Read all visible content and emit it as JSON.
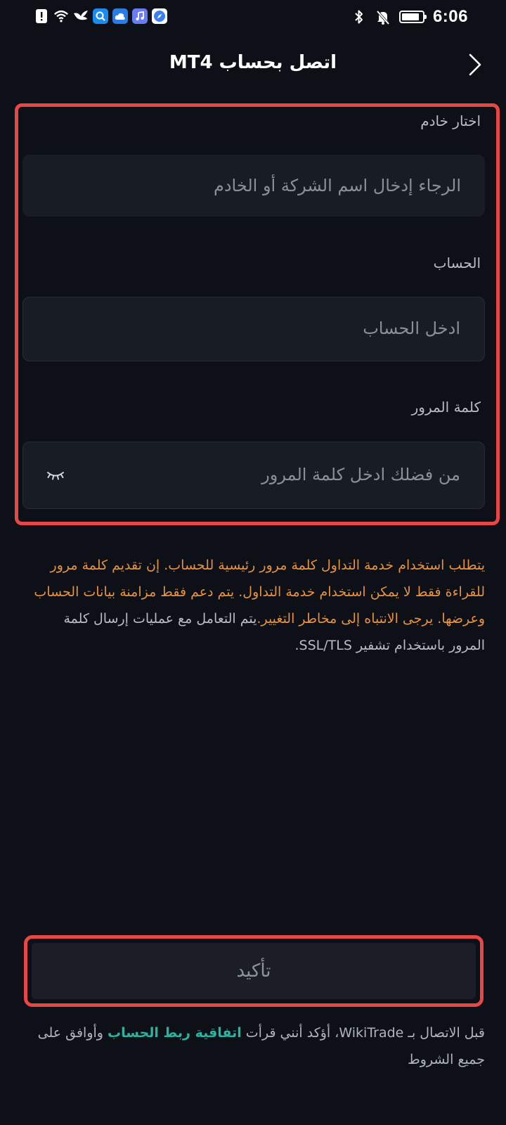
{
  "status_bar": {
    "time": "6:06",
    "battery_level": 0.85,
    "left_icons": [
      "alert-icon",
      "wifi-icon",
      "bird-icon",
      "search-app-icon",
      "cloud-app-icon",
      "music-app-icon",
      "compass-app-icon"
    ],
    "right_icons": [
      "bluetooth-icon",
      "bell-muted-icon",
      "battery-icon"
    ]
  },
  "header": {
    "title": "اتصل بحساب MT4",
    "back_icon": "chevron-right-icon"
  },
  "form": {
    "server": {
      "label": "اختار خادم",
      "placeholder": "الرجاء إدخال اسم الشركة أو الخادم"
    },
    "account": {
      "label": "الحساب",
      "placeholder": "ادخل الحساب"
    },
    "password": {
      "label": "كلمة المرور",
      "placeholder": "من فضلك ادخل كلمة المرور",
      "toggle_icon": "eye-closed-icon"
    }
  },
  "notice": {
    "warning_text": "يتطلب استخدام خدمة التداول كلمة مرور رئيسية للحساب. إن تقديم كلمة مرور للقراءة فقط لا يمكن استخدام خدمة التداول. يتم دعم فقط مزامنة بيانات الحساب وعرضها. يرجى الانتباه إلى مخاطر التغيير.",
    "info_text": "يتم التعامل مع عمليات إرسال كلمة المرور باستخدام تشفير SSL/TLS."
  },
  "confirm_label": "تأكيد",
  "agreement": {
    "before": "قبل الاتصال بـ WikiTrade، أؤكد أنني قرأت ",
    "link": "اتفاقية ربط الحساب",
    "after": " وأوافق على جميع الشروط"
  },
  "colors": {
    "background": "#0d1017",
    "highlight_border": "#e94745",
    "warning": "#e8923e",
    "link": "#2bb3a0"
  }
}
